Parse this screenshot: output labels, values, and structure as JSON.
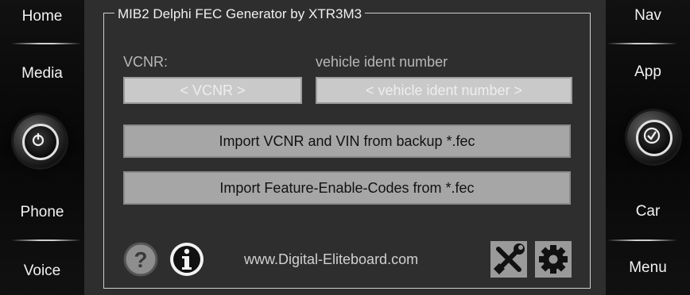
{
  "left_panel": {
    "home": "Home",
    "media": "Media",
    "phone": "Phone",
    "voice": "Voice",
    "knob_icon": "power-icon"
  },
  "right_panel": {
    "nav": "Nav",
    "app": "App",
    "car": "Car",
    "menu": "Menu",
    "knob_icon": "check-icon"
  },
  "main": {
    "title": "MIB2 Delphi FEC Generator by XTR3M3",
    "vcnr_label": "VCNR:",
    "vcnr_placeholder": "< VCNR >",
    "vin_label": "vehicle ident number",
    "vin_placeholder": "< vehicle ident number >",
    "import_vin_button": "Import VCNR and VIN from backup *.fec",
    "import_fec_button": "Import Feature-Enable-Codes from *.fec",
    "website": "www.Digital-Eliteboard.com",
    "icons": [
      "help-icon",
      "info-icon",
      "tools-icon",
      "settings-icon"
    ]
  },
  "colors": {
    "background": "#2e2e2e",
    "button": "#a6a6a6",
    "field": "#c9c9c9",
    "text": "#e6e6e6"
  }
}
